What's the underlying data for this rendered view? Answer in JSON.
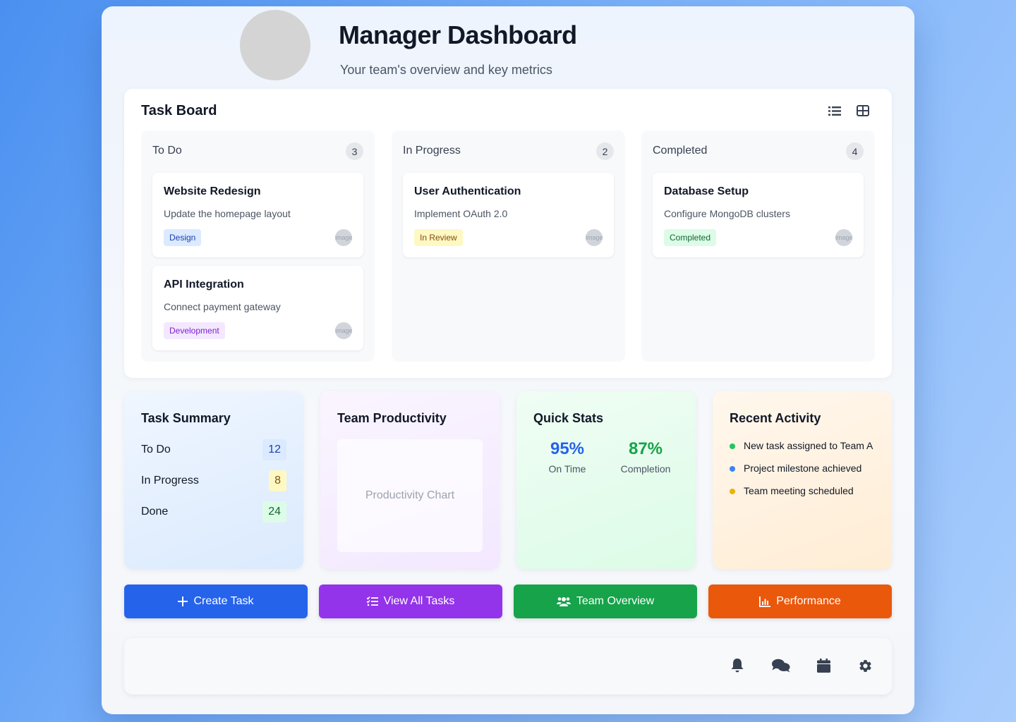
{
  "header": {
    "title": "Manager Dashboard",
    "subtitle": "Your team's overview and key metrics"
  },
  "board": {
    "title": "Task Board",
    "view_icons": [
      "list-icon",
      "grid-icon"
    ],
    "columns": [
      {
        "title": "To Do",
        "count": "3",
        "cards": [
          {
            "title": "Website Redesign",
            "desc": "Update the homepage layout",
            "tag": "Design",
            "tag_bg": "#dbeafe",
            "tag_color": "#1e40af",
            "avatar": "image"
          },
          {
            "title": "API Integration",
            "desc": "Connect payment gateway",
            "tag": "Development",
            "tag_bg": "#f3e8ff",
            "tag_color": "#7e22ce",
            "avatar": "image"
          }
        ]
      },
      {
        "title": "In Progress",
        "count": "2",
        "cards": [
          {
            "title": "User Authentication",
            "desc": "Implement OAuth 2.0",
            "tag": "In Review",
            "tag_bg": "#fef9c3",
            "tag_color": "#854d0e",
            "avatar": "image"
          }
        ]
      },
      {
        "title": "Completed",
        "count": "4",
        "cards": [
          {
            "title": "Database Setup",
            "desc": "Configure MongoDB clusters",
            "tag": "Completed",
            "tag_bg": "#dcfce7",
            "tag_color": "#166534",
            "avatar": "image"
          }
        ]
      }
    ]
  },
  "summary": {
    "title": "Task Summary",
    "rows": [
      {
        "label": "To Do",
        "value": "12",
        "bg": "#dbeafe",
        "color": "#1e40af"
      },
      {
        "label": "In Progress",
        "value": "8",
        "bg": "#fef9c3",
        "color": "#854d0e"
      },
      {
        "label": "Done",
        "value": "24",
        "bg": "#dcfce7",
        "color": "#166534"
      }
    ]
  },
  "productivity": {
    "title": "Team Productivity",
    "chart_placeholder": "Productivity Chart"
  },
  "quick_stats": {
    "title": "Quick Stats",
    "stats": [
      {
        "value": "95%",
        "label": "On Time",
        "color": "#2563eb"
      },
      {
        "value": "87%",
        "label": "Completion",
        "color": "#16a34a"
      }
    ]
  },
  "activity": {
    "title": "Recent Activity",
    "items": [
      {
        "text": "New task assigned to Team A",
        "color": "#22c55e"
      },
      {
        "text": "Project milestone achieved",
        "color": "#3b82f6"
      },
      {
        "text": "Team meeting scheduled",
        "color": "#eab308"
      }
    ]
  },
  "actions": [
    {
      "label": "Create Task",
      "icon": "plus-icon",
      "color": "#2563eb"
    },
    {
      "label": "View All Tasks",
      "icon": "task-list-icon",
      "color": "#9333ea"
    },
    {
      "label": "Team Overview",
      "icon": "users-icon",
      "color": "#16a34a"
    },
    {
      "label": "Performance",
      "icon": "chart-bar-icon",
      "color": "#ea580c"
    }
  ],
  "footer": {
    "icons": [
      "bell-icon",
      "chat-icon",
      "calendar-icon",
      "gear-icon"
    ]
  }
}
